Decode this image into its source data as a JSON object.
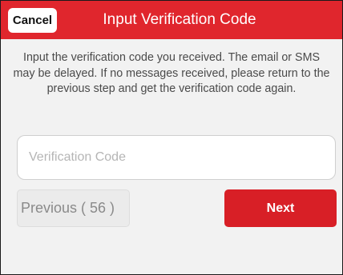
{
  "header": {
    "cancel_label": "Cancel",
    "title": "Input Verification Code"
  },
  "instructions": "Input the verification code you received. The email or SMS may be delayed. If no messages received, please return to the previous step and get the verification code again.",
  "form": {
    "code_placeholder": "Verification Code",
    "code_value": ""
  },
  "buttons": {
    "previous_label": "Previous ( 56 )",
    "next_label": "Next"
  },
  "colors": {
    "header_bg": "#e0262d",
    "next_bg": "#d81f26",
    "page_bg": "#f2f2f2"
  }
}
